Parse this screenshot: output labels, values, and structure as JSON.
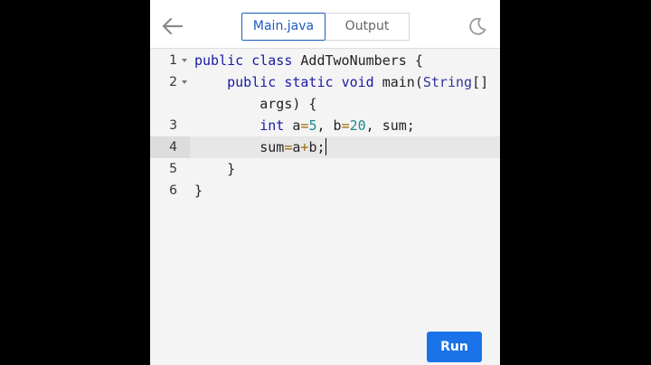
{
  "header": {
    "back_icon": "arrow-left-icon",
    "tabs": [
      {
        "label": "Main.java",
        "active": true
      },
      {
        "label": "Output",
        "active": false
      }
    ],
    "theme_icon": "moon-icon"
  },
  "editor": {
    "active_line": 4,
    "lines": [
      {
        "number": "1",
        "foldable": true,
        "tokens": [
          {
            "t": "public",
            "c": "kw"
          },
          {
            "t": " "
          },
          {
            "t": "class",
            "c": "kw"
          },
          {
            "t": " AddTwoNumbers {"
          }
        ]
      },
      {
        "number": "2",
        "foldable": true,
        "tokens": [
          {
            "t": "    "
          },
          {
            "t": "public",
            "c": "kw"
          },
          {
            "t": " "
          },
          {
            "t": "static",
            "c": "kw"
          },
          {
            "t": " "
          },
          {
            "t": "void",
            "c": "kw"
          },
          {
            "t": " main("
          },
          {
            "t": "String",
            "c": "tp"
          },
          {
            "t": "[]"
          }
        ]
      },
      {
        "number": "",
        "foldable": false,
        "tokens": [
          {
            "t": "        args) {"
          }
        ]
      },
      {
        "number": "3",
        "foldable": false,
        "tokens": [
          {
            "t": "        "
          },
          {
            "t": "int",
            "c": "kw"
          },
          {
            "t": " a"
          },
          {
            "t": "=",
            "c": "op"
          },
          {
            "t": "5",
            "c": "num"
          },
          {
            "t": ", b"
          },
          {
            "t": "=",
            "c": "op"
          },
          {
            "t": "20",
            "c": "num"
          },
          {
            "t": ", sum;"
          }
        ]
      },
      {
        "number": "4",
        "foldable": false,
        "active": true,
        "cursor": true,
        "tokens": [
          {
            "t": "        sum"
          },
          {
            "t": "=",
            "c": "op"
          },
          {
            "t": "a"
          },
          {
            "t": "+",
            "c": "op"
          },
          {
            "t": "b;"
          }
        ]
      },
      {
        "number": "5",
        "foldable": false,
        "tokens": [
          {
            "t": "    }"
          }
        ]
      },
      {
        "number": "6",
        "foldable": false,
        "tokens": [
          {
            "t": "}"
          }
        ]
      }
    ]
  },
  "footer": {
    "run_label": "Run",
    "run_color": "#1a73e8"
  }
}
